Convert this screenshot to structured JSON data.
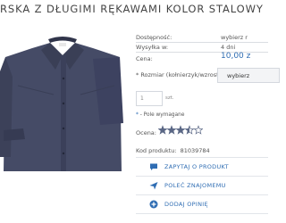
{
  "product": {
    "title": "RSKA Z DŁUGIMI RĘKAWAMI KOLOR STALOWY",
    "availability_label": "Dostępność:",
    "availability_value": "wybierz r",
    "shipping_label": "Wysyłka w:",
    "shipping_value": "4 dni",
    "price_label": "Cena:",
    "price_value": "10,00 z",
    "size_label": "* Rozmiar (kołnierzyk/wzrost):",
    "size_select_value": "wybierz",
    "qty_value": "1",
    "qty_unit": "szt.",
    "required_star": "*",
    "required_note": " - Pole wymagane",
    "rating_label": "Ocena:",
    "rating_value": 3.5,
    "rating_max": 5,
    "code_label": "Kod produktu:",
    "code_value": "81039784"
  },
  "actions": [
    {
      "label": "ZAPYTAJ O PRODUKT",
      "icon": "chat-icon"
    },
    {
      "label": "POLEĆ ZNAJOMEMU",
      "icon": "send-icon"
    },
    {
      "label": "DODAJ OPINIĘ",
      "icon": "add-icon"
    }
  ],
  "colors": {
    "accent": "#2f6db3",
    "shirt": "#454b66",
    "star": "#5a6785"
  }
}
